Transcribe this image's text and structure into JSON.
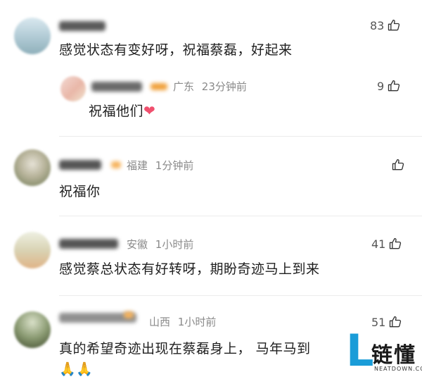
{
  "comments": [
    {
      "location": "",
      "time": "",
      "likes": "83",
      "text": "感觉状态有变好呀，祝福蔡磊，好起来"
    },
    {
      "location": "广东",
      "time": "23分钟前",
      "likes": "9",
      "text": "祝福他们",
      "emoji": "❤️"
    },
    {
      "location": "福建",
      "time": "1分钟前",
      "likes": "",
      "text": "祝福你"
    },
    {
      "location": "安徽",
      "time": "1小时前",
      "likes": "41",
      "text": "感觉蔡总状态有好转呀，期盼奇迹马上到来"
    },
    {
      "location": "山西",
      "time": "1小时前",
      "likes": "51",
      "text": "真的希望奇迹出现在蔡磊身上，  马年马到",
      "emoji": "🙏🙏"
    }
  ],
  "watermark": {
    "letter": "L",
    "name": "链懂",
    "domain": "NEATDOWN.COM"
  },
  "colors": {
    "like_icon": "#333333",
    "heart": "#f0506e",
    "logo_blue": "#1a9cd8"
  }
}
